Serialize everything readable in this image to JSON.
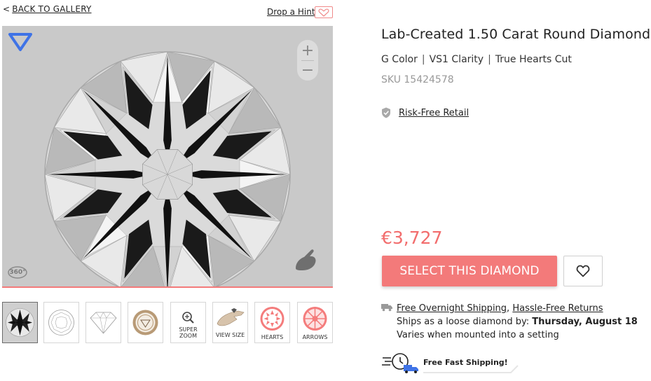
{
  "nav": {
    "back_chevron": "<",
    "back_label": "BACK TO GALLERY",
    "hint_label": "Drop a Hint"
  },
  "viewer": {
    "zoom_in": "+",
    "zoom_out": "−",
    "spin_label": "360°",
    "thumbnails": [
      {
        "name": "thumb-face-up",
        "label": "",
        "active": true
      },
      {
        "name": "thumb-top-diagram",
        "label": ""
      },
      {
        "name": "thumb-profile-diagram",
        "label": ""
      },
      {
        "name": "thumb-certificate",
        "label": ""
      },
      {
        "name": "thumb-super-zoom",
        "label": "SUPER\nZOOM"
      },
      {
        "name": "thumb-view-size",
        "label": "VIEW SIZE"
      },
      {
        "name": "thumb-hearts",
        "label": "HEARTS"
      },
      {
        "name": "thumb-arrows",
        "label": "ARROWS"
      }
    ]
  },
  "product": {
    "title": "Lab-Created 1.50 Carat Round Diamond",
    "color": "G Color",
    "clarity": "VS1 Clarity",
    "cut": "True Hearts Cut",
    "spec_separator": "|",
    "sku": "SKU 15424578",
    "risk_free": "Risk-Free Retail",
    "price": "€3,727",
    "select_label": "SELECT THIS DIAMOND"
  },
  "shipping": {
    "overnight": "Free Overnight Shipping",
    "comma": ",",
    "returns": "Hassle-Free Returns",
    "ships_prefix": "Ships as a loose diamond by: ",
    "ships_date": "Thursday, August 18",
    "mounted_note": "Varies when mounted into a setting",
    "fast_label": "Free Fast Shipping!"
  },
  "colors": {
    "accent": "#f37a7a",
    "price": "#f26d6d",
    "logo_blue": "#3f73e6",
    "viewer_bg": "#cbcbcb"
  },
  "icons": [
    "diamond-logo-icon",
    "heart-outline-icon",
    "plus-icon",
    "minus-icon",
    "spin-360-icon",
    "hand-icon",
    "shield-check-icon",
    "truck-icon",
    "fast-shipping-icon",
    "magnifier-icon"
  ]
}
